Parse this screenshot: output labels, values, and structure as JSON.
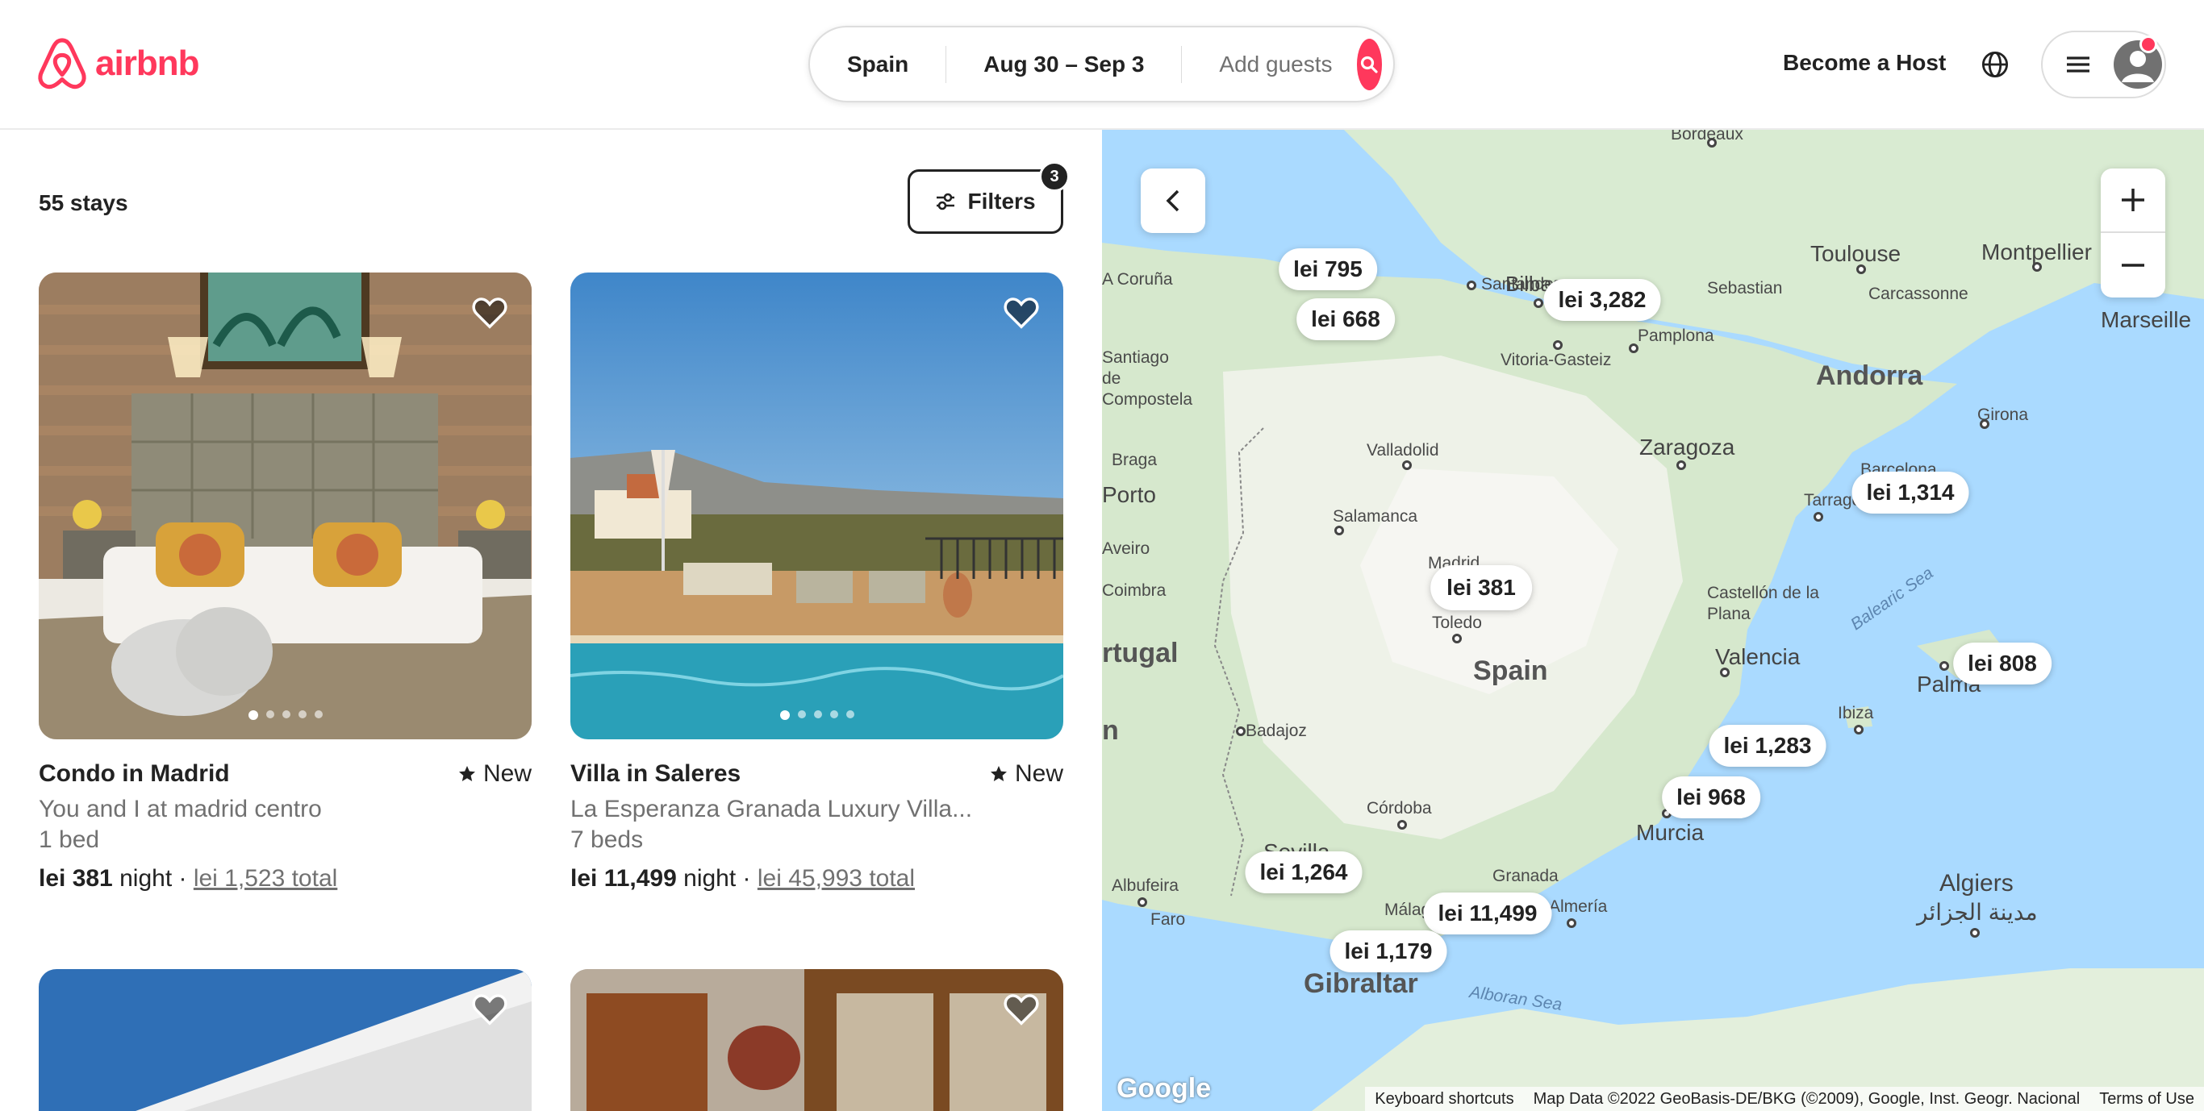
{
  "brand": {
    "name": "airbnb",
    "color": "#ff385c"
  },
  "search": {
    "location": "Spain",
    "dates": "Aug 30 – Sep 3",
    "guests_placeholder": "Add guests"
  },
  "nav": {
    "host_label": "Become a Host"
  },
  "results": {
    "count_label": "55 stays",
    "filters_label": "Filters",
    "filters_count": "3"
  },
  "listings": [
    {
      "title": "Condo in Madrid",
      "badge": "New",
      "subtitle": "You and I at madrid centro",
      "beds": "1 bed",
      "price": "lei 381",
      "price_unit": "night",
      "total": "lei 1,523 total",
      "photo_index": 1,
      "photo_count": 5
    },
    {
      "title": "Villa in Saleres",
      "badge": "New",
      "subtitle": "La Esperanza Granada Luxury Villa...",
      "beds": "7 beds",
      "price": "lei 11,499",
      "price_unit": "night",
      "total": "lei 45,993 total",
      "photo_index": 1,
      "photo_count": 5
    }
  ],
  "map": {
    "pins": [
      "lei 795",
      "lei 668",
      "lei 3,282",
      "lei 1,314",
      "lei 381",
      "lei 808",
      "lei 1,283",
      "lei 968",
      "lei 1,264",
      "lei 11,499",
      "lei 1,179"
    ],
    "labels": {
      "bordeaux": "Bordeaux",
      "coruna": "A Coruña",
      "santander": "Santander",
      "bilbao": "Bilbao",
      "sansebastian": "Sebastian",
      "pamplona": "Pamplona",
      "vitoria": "Vitoria-Gasteiz",
      "santiago": "Santiago de Compostela",
      "toulouse": "Toulouse",
      "montpellier": "Montpellier",
      "carcassonne": "Carcassonne",
      "marseille": "Marseille",
      "andorra": "Andorra",
      "girona": "Girona",
      "zaragoza": "Zaragoza",
      "valladolid": "Valladolid",
      "braga": "Braga",
      "porto": "Porto",
      "salamanca": "Salamanca",
      "barcelona": "Barcelona",
      "tarragona": "Tarrago",
      "madrid": "Madrid",
      "toledo": "Toledo",
      "aveiro": "Aveiro",
      "coimbra": "Coimbra",
      "castellon": "Castellón de la Plana",
      "balearic": "Balearic Sea",
      "portugal": "rtugal",
      "spain": "Spain",
      "valencia": "Valencia",
      "palma": "Palma",
      "ibiza": "Ibiza",
      "badajoz": "Badajoz",
      "lisbon": "n",
      "cordoba": "Córdoba",
      "murcia": "Murcia",
      "sevilla": "Sevilla",
      "albufeira": "Albufeira",
      "faro": "Faro",
      "granada": "Granada",
      "almeria": "Almería",
      "malaga": "Málaga",
      "algiers": "Algiers",
      "algiers_ar": "مدينة الجزائر",
      "gibraltar": "Gibraltar",
      "alboran": "Alboran Sea"
    },
    "attribution": {
      "google": "Google",
      "shortcuts": "Keyboard shortcuts",
      "data": "Map Data ©2022 GeoBasis-DE/BKG (©2009), Google, Inst. Geogr. Nacional",
      "terms": "Terms of Use"
    }
  }
}
